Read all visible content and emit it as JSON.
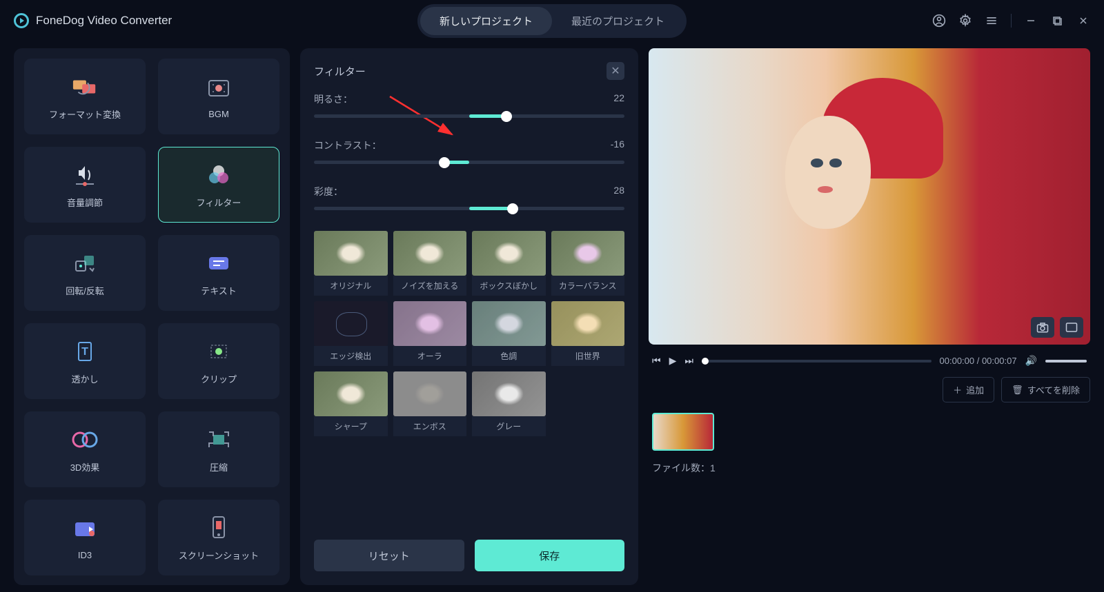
{
  "app_title": "FoneDog Video Converter",
  "tabs": {
    "new": "新しいプロジェクト",
    "recent": "最近のプロジェクト"
  },
  "tools": [
    {
      "label": "フォーマット変換",
      "icon": "format"
    },
    {
      "label": "BGM",
      "icon": "bgm"
    },
    {
      "label": "音量調節",
      "icon": "volume"
    },
    {
      "label": "フィルター",
      "icon": "filter",
      "active": true
    },
    {
      "label": "回転/反転",
      "icon": "rotate"
    },
    {
      "label": "テキスト",
      "icon": "text"
    },
    {
      "label": "透かし",
      "icon": "watermark"
    },
    {
      "label": "クリップ",
      "icon": "clip"
    },
    {
      "label": "3D効果",
      "icon": "3d"
    },
    {
      "label": "圧縮",
      "icon": "compress"
    },
    {
      "label": "ID3",
      "icon": "id3"
    },
    {
      "label": "スクリーンショット",
      "icon": "screenshot"
    }
  ],
  "filter_panel": {
    "title": "フィルター",
    "sliders": {
      "brightness": {
        "label": "明るさ：",
        "value": 22,
        "min": -50,
        "max": 50,
        "fill_start": 50,
        "fill_end": 62,
        "thumb": 62
      },
      "contrast": {
        "label": "コントラスト：",
        "value": -16,
        "min": -50,
        "max": 50,
        "fill_start": 42,
        "fill_end": 50,
        "thumb": 42
      },
      "saturation": {
        "label": "彩度：",
        "value": 28,
        "min": -50,
        "max": 50,
        "fill_start": 50,
        "fill_end": 64,
        "thumb": 64
      }
    },
    "presets": [
      "オリジナル",
      "ノイズを加える",
      "ボックスぼかし",
      "カラーバランス",
      "エッジ検出",
      "オーラ",
      "色調",
      "旧世界",
      "シャープ",
      "エンボス",
      "グレー"
    ],
    "reset": "リセット",
    "save": "保存"
  },
  "player": {
    "time": "00:00:00 / 00:00:07"
  },
  "clips": {
    "add": "追加",
    "remove_all": "すべてを削除",
    "count_label": "ファイル数：1"
  }
}
